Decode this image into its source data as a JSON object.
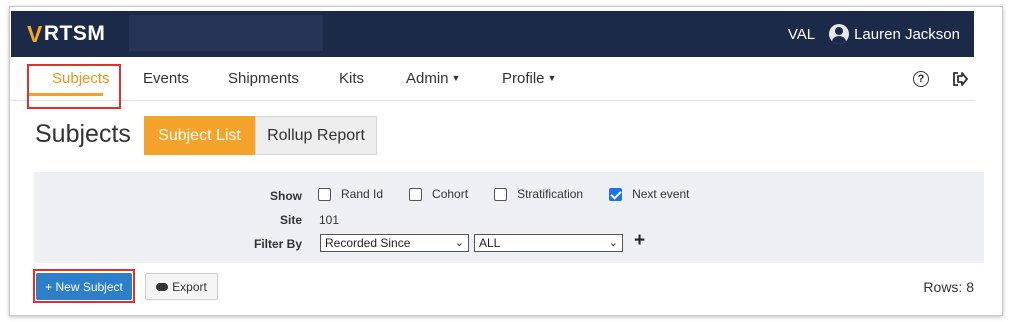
{
  "topbar": {
    "logo_letter": "V",
    "logo_text": "RTSM",
    "env": "VAL",
    "user_name": "Lauren Jackson"
  },
  "nav": {
    "items": [
      {
        "label": "Subjects",
        "active": true
      },
      {
        "label": "Events"
      },
      {
        "label": "Shipments"
      },
      {
        "label": "Kits"
      },
      {
        "label": "Admin",
        "dropdown": true
      },
      {
        "label": "Profile",
        "dropdown": true
      }
    ],
    "help_icon": "help-circle-icon",
    "logout_icon": "logout-icon",
    "help_glyph": "?"
  },
  "page": {
    "title": "Subjects",
    "tabs": [
      {
        "label": "Subject List",
        "selected": true
      },
      {
        "label": "Rollup Report",
        "selected": false
      }
    ]
  },
  "filters": {
    "show_label": "Show",
    "options": [
      {
        "label": "Rand Id",
        "checked": false
      },
      {
        "label": "Cohort",
        "checked": false
      },
      {
        "label": "Stratification",
        "checked": false
      },
      {
        "label": "Next event",
        "checked": true
      }
    ],
    "site_label": "Site",
    "site_value": "101",
    "filter_by_label": "Filter By",
    "filter_by_value": "Recorded Since",
    "filter_value": "ALL",
    "add_glyph": "+"
  },
  "actions": {
    "new_subject": "+ New Subject",
    "export": "Export",
    "rows": "Rows: 8"
  },
  "colors": {
    "accent": "#f5a32a",
    "header_bg": "#1c2a4a",
    "primary_button": "#2d7fc8",
    "highlight_box": "#e03030"
  }
}
